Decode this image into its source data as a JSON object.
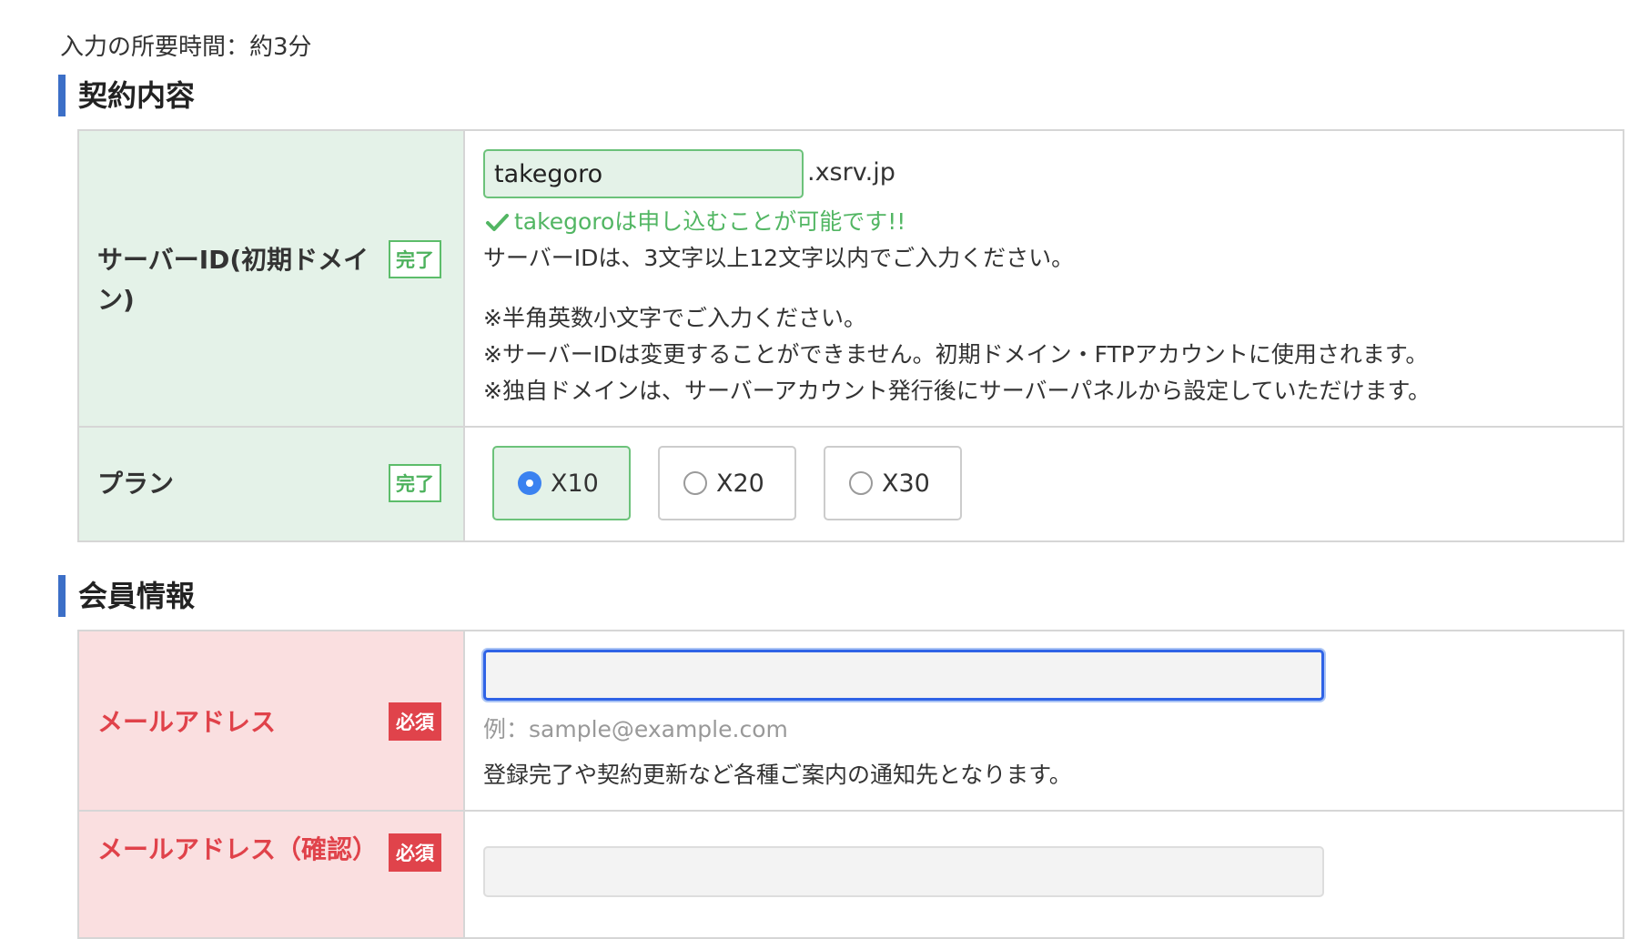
{
  "time_note": "入力の所要時間：約3分",
  "contract_section": {
    "title": "契約内容",
    "server_id": {
      "label": "サーバーID(初期ドメイン)",
      "badge": "完了",
      "value": "takegoro",
      "suffix": ".xsrv.jp",
      "ok_message": "takegoroは申し込むことが可能です!!",
      "help": [
        "サーバーIDは、3文字以上12文字以内でご入力ください。",
        "※半角英数小文字でご入力ください。",
        "※サーバーIDは変更することができません。初期ドメイン・FTPアカウントに使用されます。",
        "※独自ドメインは、サーバーアカウント発行後にサーバーパネルから設定していただけます。"
      ]
    },
    "plan": {
      "label": "プラン",
      "badge": "完了",
      "options": [
        "X10",
        "X20",
        "X30"
      ],
      "selected": "X10"
    }
  },
  "member_section": {
    "title": "会員情報",
    "email": {
      "label": "メールアドレス",
      "badge": "必須",
      "value": "",
      "hint": "例：sample@example.com",
      "note": "登録完了や契約更新など各種ご案内の通知先となります。"
    },
    "email_confirm": {
      "label": "メールアドレス（確認）",
      "badge": "必須",
      "value": ""
    }
  },
  "colors": {
    "accent_bar": "#3c6fc7",
    "ok_green": "#52b663",
    "required_red": "#e0434b",
    "focus_blue": "#2f63e6"
  }
}
